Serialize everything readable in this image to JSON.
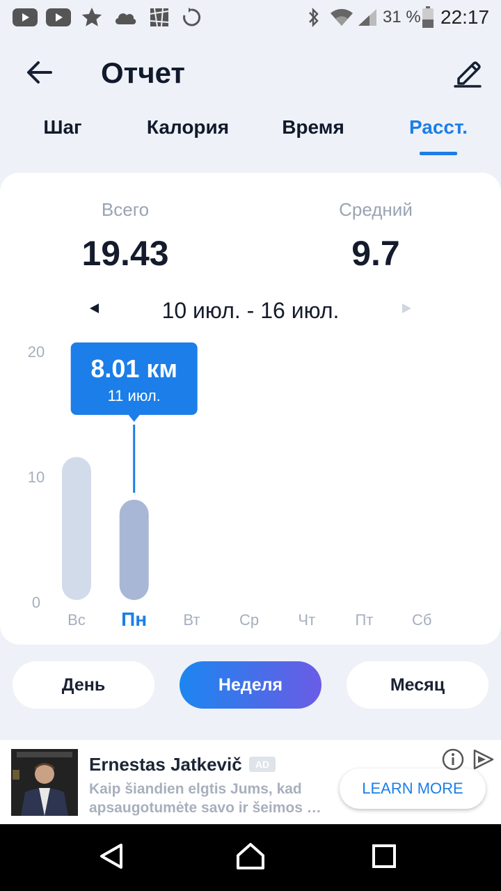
{
  "status_bar": {
    "battery": "31 %",
    "time": "22:17",
    "icons": [
      "youtube-icon",
      "youtube-icon",
      "star-icon",
      "cloud-icon",
      "image-icon",
      "sync-icon",
      "bluetooth-icon",
      "wifi-icon",
      "signal-icon",
      "battery-icon"
    ]
  },
  "header": {
    "title": "Отчет",
    "back_icon": "arrow-left-icon",
    "edit_icon": "pencil-icon"
  },
  "tabs": [
    {
      "label": "Шаг",
      "active": false
    },
    {
      "label": "Калория",
      "active": false
    },
    {
      "label": "Время",
      "active": false
    },
    {
      "label": "Расст.",
      "active": true
    }
  ],
  "summary": {
    "total_label": "Всего",
    "total_value": "19.43",
    "average_label": "Средний",
    "average_value": "9.7"
  },
  "range": {
    "text": "10 июл. - 16 июл."
  },
  "chart_data": {
    "type": "bar",
    "categories": [
      "Вс",
      "Пн",
      "Вт",
      "Ср",
      "Чт",
      "Пт",
      "Сб"
    ],
    "values": [
      11.42,
      8.01,
      null,
      null,
      null,
      null,
      null
    ],
    "selected_index": 1,
    "ylim": [
      0,
      20
    ],
    "yticks": [
      0,
      10,
      20
    ],
    "tooltip": {
      "value": "8.01 км",
      "date": "11 июл."
    },
    "colors": {
      "bar": "#d2dbea",
      "selected_bar": "#a9b7d6",
      "tooltip": "#1c7ee8",
      "axis_text": "#a6aebd",
      "selected_label": "#1c7ee8"
    }
  },
  "period_buttons": [
    {
      "label": "День",
      "active": false
    },
    {
      "label": "Неделя",
      "active": true
    },
    {
      "label": "Месяц",
      "active": false
    }
  ],
  "ad": {
    "title": "Ernestas Jatkevič",
    "badge": "AD",
    "description_line1": "Kaip šiandien elgtis Jums, kad",
    "description_line2": "apsaugotumėte savo ir šeimos pi...",
    "cta": "LEARN MORE"
  },
  "colors": {
    "accent": "#1c7ee8",
    "background": "#eef1f7",
    "card": "#ffffff"
  }
}
